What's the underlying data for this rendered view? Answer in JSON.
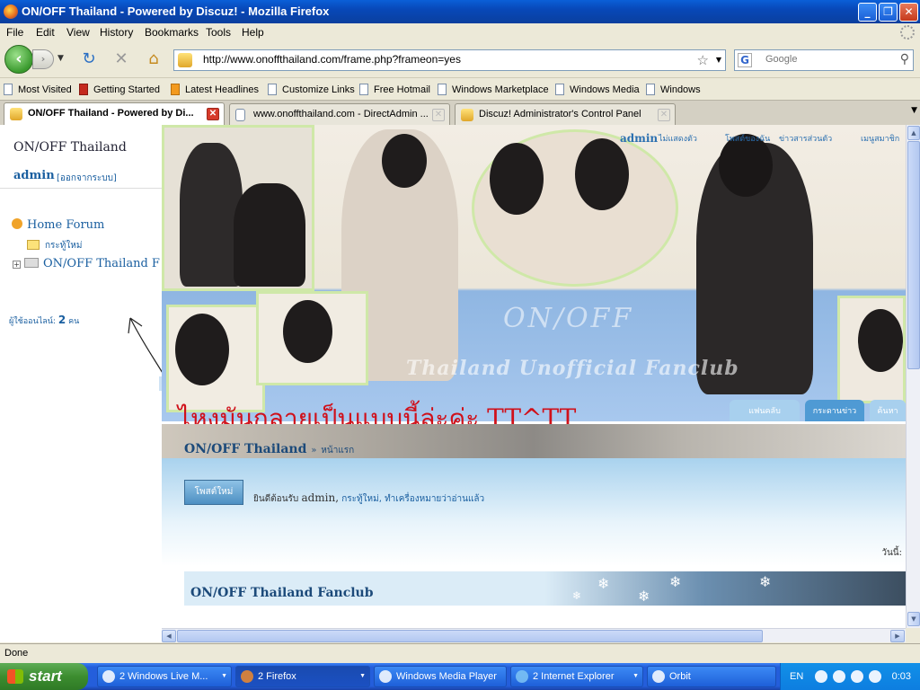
{
  "window": {
    "title": "ON/OFF Thailand - Powered by Discuz! - Mozilla Firefox"
  },
  "menu": [
    "File",
    "Edit",
    "View",
    "History",
    "Bookmarks",
    "Tools",
    "Help"
  ],
  "nav": {
    "url": "http://www.onoffthailand.com/frame.php?frameon=yes",
    "search_placeholder": "Google"
  },
  "bookmarks": [
    "Most Visited",
    "Getting Started",
    "Latest Headlines",
    "Customize Links",
    "Free Hotmail",
    "Windows Marketplace",
    "Windows Media",
    "Windows"
  ],
  "tabs": [
    {
      "label": "ON/OFF Thailand - Powered by Di...",
      "active": true
    },
    {
      "label": "www.onoffthailand.com - DirectAdmin ...",
      "active": false
    },
    {
      "label": "Discuz! Administrator's Control Panel",
      "active": false
    }
  ],
  "sidebar": {
    "site_name": "ON/OFF Thailand",
    "username": "admin",
    "logout": "[ออกจากระบบ]",
    "tree": {
      "home": "Home Forum",
      "new_topic": "กระทู้ใหม่",
      "forum": "ON/OFF Thailand F"
    },
    "online_label": "ผู้ใช้ออนไลน์:",
    "online_count": "2",
    "online_unit": "คน"
  },
  "forum": {
    "top_links": {
      "admin": "admin",
      "profile": "ไม่แสดงตัว",
      "my_posts": "โพสต์ของฉัน",
      "messages": "ข่าวสารส่วนตัว",
      "members": "เมนูสมาชิก"
    },
    "banner_text": [
      "ON/OFF",
      "Thailand Unofficial Fanclub"
    ],
    "annotation": "ไหงมันกลายเป็นแบบนี้ล่ะค่ะ TT^TT",
    "nav_tabs": [
      "แฟนคลับ",
      "กระดานข่าว",
      "ค้นหา"
    ],
    "breadcrumb_site": "ON/OFF Thailand",
    "breadcrumb_sep": "»",
    "breadcrumb_page": "หน้าแรก",
    "new_post_button": "โพสต์ใหม่",
    "welcome_prefix": "ยินดีต้อนรับ",
    "welcome_user": "admin,",
    "welcome_link1": "กระทู้ใหม่,",
    "welcome_link2": "ทำเครื่องหมายว่าอ่านแล้ว",
    "today_label": "วันนี้:",
    "section_title": "ON/OFF Thailand Fanclub"
  },
  "status": "Done",
  "taskbar": {
    "start": "start",
    "buttons": [
      "2 Windows Live M...",
      "2 Firefox",
      "Windows Media Player",
      "2 Internet Explorer",
      "Orbit"
    ],
    "lang": "EN",
    "clock": "0:03"
  },
  "colors": {
    "titlebar": "#0a5fd8",
    "link_blue": "#1a5fa0",
    "annotation_red": "#d0101a",
    "banner_blue": "#8fb6e2"
  }
}
